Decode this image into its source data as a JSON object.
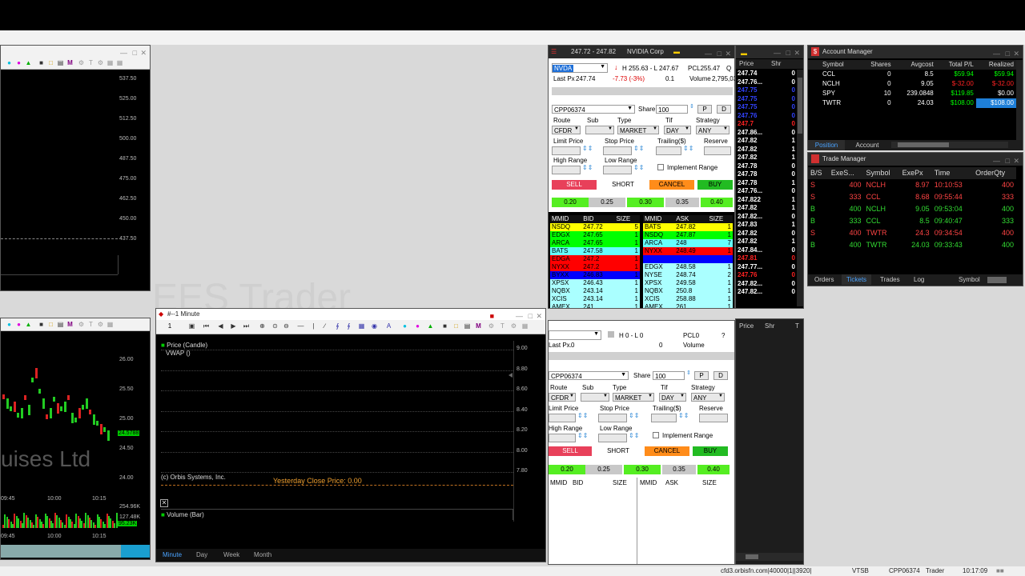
{
  "desktop": {
    "watermark": "EES Trader"
  },
  "chart_top_left": {
    "y_ticks": [
      "537.50",
      "525.00",
      "512.50",
      "500.00",
      "487.50",
      "475.00",
      "462.50",
      "450.00",
      "437.50"
    ]
  },
  "chart_bottom_left": {
    "y_ticks": [
      "26.00",
      "25.50",
      "25.00",
      "24.50",
      "24.00"
    ],
    "price_tag": "24.5788",
    "vol_ticks": [
      "254.96K",
      "127.48K"
    ],
    "vol_tag": "95.23K",
    "x_ticks": [
      "09:45",
      "10:00",
      "10:15"
    ],
    "x_ticks2": [
      "09:45",
      "10:00",
      "10:15"
    ],
    "watermark": "uises Ltd"
  },
  "minute_chart": {
    "title": "#--1 Minute",
    "legend_price": "Price (Candle)",
    "legend_vwap": "VWAP ()",
    "y_ticks": [
      "9.00",
      "8.80",
      "8.60",
      "8.40",
      "8.20",
      "8.00",
      "7.80"
    ],
    "copyright": "(c) Orbis Systems, Inc.",
    "yesterday_close": "Yesterday Close Price: 0.00",
    "volume_legend": "Volume (Bar)",
    "tabs": [
      "Minute",
      "Day",
      "Week",
      "Month"
    ],
    "toolbar_one": "1"
  },
  "order_window_1": {
    "title_range": "247.72 - 247.82",
    "company": "NVIDIA Corp",
    "symbol": "NVDA",
    "hl": "H 255.63 - L 247.67",
    "pcl": "PCL255.47",
    "q": "Q",
    "last_px_label": "Last Px",
    "last_px": "247.74",
    "change": "-7.73 (-3%)",
    "chg2": "0.1",
    "volume_label": "Volume",
    "volume": "2,795,03",
    "account": "CPP06374",
    "share_label": "Share",
    "share": "100",
    "p": "P",
    "d": "D",
    "route_label": "Route",
    "sub_label": "Sub",
    "type_label": "Type",
    "tif_label": "Tif",
    "strategy_label": "Strategy",
    "route": "CFDR",
    "type": "MARKET",
    "tif": "DAY",
    "strategy": "ANY",
    "limit_label": "Limit Price",
    "stop_label": "Stop Price",
    "trailing_label": "Trailing($)",
    "reserve_label": "Reserve",
    "high_range_label": "High Range",
    "low_range_label": "Low Range",
    "implement_range": "Implement Range",
    "sell": "SELL",
    "short": "SHORT",
    "cancel": "CANCEL",
    "buy": "BUY",
    "increments": [
      "0.20",
      "0.25",
      "0.30",
      "0.35",
      "0.40"
    ],
    "bid_headers": [
      "MMID",
      "BID",
      "SIZE"
    ],
    "ask_headers": [
      "MMID",
      "ASK",
      "SIZE"
    ],
    "bids": [
      {
        "mmid": "NSDQ",
        "px": "247.72",
        "size": "5",
        "color": "#ffff00"
      },
      {
        "mmid": "EDGX",
        "px": "247.65",
        "size": "1",
        "color": "#00ff00"
      },
      {
        "mmid": "ARCA",
        "px": "247.65",
        "size": "1",
        "color": "#00ff00"
      },
      {
        "mmid": "BATS",
        "px": "247.58",
        "size": "1",
        "color": "#66ffff"
      },
      {
        "mmid": "EDGA",
        "px": "247.2",
        "size": "1",
        "color": "#ff0000"
      },
      {
        "mmid": "NYXX",
        "px": "247.2",
        "size": "1",
        "color": "#ff0000"
      },
      {
        "mmid": "BYXX",
        "px": "246.83",
        "size": "1",
        "color": "#0000ff"
      },
      {
        "mmid": "XPSX",
        "px": "246.43",
        "size": "1",
        "color": "#aaffff"
      },
      {
        "mmid": "NQBX",
        "px": "243.14",
        "size": "1",
        "color": "#aaffff"
      },
      {
        "mmid": "XCIS",
        "px": "243.14",
        "size": "1",
        "color": "#aaffff"
      },
      {
        "mmid": "AMEX",
        "px": "241",
        "size": "1",
        "color": "#aaffff"
      }
    ],
    "asks": [
      {
        "mmid": "BATS",
        "px": "247.82",
        "size": "1",
        "color": "#ffff00"
      },
      {
        "mmid": "NSDQ",
        "px": "247.87",
        "size": "1",
        "color": "#00ff00"
      },
      {
        "mmid": "ARCA",
        "px": "248",
        "size": "7",
        "color": "#66ffff"
      },
      {
        "mmid": "NYXX",
        "px": "248.49",
        "size": "1",
        "color": "#ff0000"
      },
      {
        "mmid": "",
        "px": "",
        "size": "",
        "color": "#0000ff"
      },
      {
        "mmid": "EDGX",
        "px": "248.58",
        "size": "1",
        "color": "#aaffff"
      },
      {
        "mmid": "NYSE",
        "px": "248.74",
        "size": "2",
        "color": "#aaffff"
      },
      {
        "mmid": "XPSX",
        "px": "249.58",
        "size": "1",
        "color": "#aaffff"
      },
      {
        "mmid": "NQBX",
        "px": "250.8",
        "size": "1",
        "color": "#aaffff"
      },
      {
        "mmid": "XCIS",
        "px": "258.88",
        "size": "1",
        "color": "#aaffff"
      },
      {
        "mmid": "AMEX",
        "px": "261",
        "size": "1",
        "color": "#aaffff"
      }
    ]
  },
  "order_window_2": {
    "hl": "H 0 - L 0",
    "pcl": "PCL0",
    "q": "?",
    "last_px_label": "Last Px.",
    "last_px": "0",
    "chg": "0",
    "volume_label": "Volume",
    "account": "CPP06374",
    "share_label": "Share",
    "share": "100",
    "p": "P",
    "d": "D",
    "route_label": "Route",
    "sub_label": "Sub",
    "type_label": "Type",
    "tif_label": "Tif",
    "strategy_label": "Strategy",
    "route": "CFDR",
    "type": "MARKET",
    "tif": "DAY",
    "strategy": "ANY",
    "limit_label": "Limit Price",
    "stop_label": "Stop Price",
    "trailing_label": "Trailing($)",
    "reserve_label": "Reserve",
    "high_range_label": "High Range",
    "low_range_label": "Low Range",
    "implement_range": "Implement Range",
    "sell": "SELL",
    "short": "SHORT",
    "cancel": "CANCEL",
    "buy": "BUY",
    "increments": [
      "0.20",
      "0.25",
      "0.30",
      "0.35",
      "0.40"
    ],
    "bid_headers": [
      "MMID",
      "BID",
      "SIZE"
    ],
    "ask_headers": [
      "MMID",
      "ASK",
      "SIZE"
    ]
  },
  "time_sales_1": {
    "headers": [
      "Price",
      "Shr"
    ],
    "rows": [
      {
        "px": "247.74",
        "sh": "0",
        "c": "#ffffff"
      },
      {
        "px": "247.76...",
        "sh": "0",
        "c": "#ffffff"
      },
      {
        "px": "247.75",
        "sh": "0",
        "c": "#3344ff"
      },
      {
        "px": "247.75",
        "sh": "0",
        "c": "#3344ff"
      },
      {
        "px": "247.75",
        "sh": "0",
        "c": "#3344ff"
      },
      {
        "px": "247.76",
        "sh": "0",
        "c": "#3344ff"
      },
      {
        "px": "247.7",
        "sh": "0",
        "c": "#ff2222"
      },
      {
        "px": "247.86...",
        "sh": "0",
        "c": "#ffffff"
      },
      {
        "px": "247.82",
        "sh": "1",
        "c": "#ffffff"
      },
      {
        "px": "247.82",
        "sh": "1",
        "c": "#ffffff"
      },
      {
        "px": "247.82",
        "sh": "1",
        "c": "#ffffff"
      },
      {
        "px": "247.78",
        "sh": "0",
        "c": "#ffffff"
      },
      {
        "px": "247.78",
        "sh": "0",
        "c": "#ffffff"
      },
      {
        "px": "247.78",
        "sh": "1",
        "c": "#ffffff"
      },
      {
        "px": "247.76...",
        "sh": "0",
        "c": "#ffffff"
      },
      {
        "px": "247.822",
        "sh": "1",
        "c": "#ffffff"
      },
      {
        "px": "247.82",
        "sh": "1",
        "c": "#ffffff"
      },
      {
        "px": "247.82...",
        "sh": "0",
        "c": "#ffffff"
      },
      {
        "px": "247.83",
        "sh": "1",
        "c": "#ffffff"
      },
      {
        "px": "247.82",
        "sh": "0",
        "c": "#ffffff"
      },
      {
        "px": "247.82",
        "sh": "1",
        "c": "#ffffff"
      },
      {
        "px": "247.84...",
        "sh": "0",
        "c": "#ffffff"
      },
      {
        "px": "247.81",
        "sh": "0",
        "c": "#ff2222"
      },
      {
        "px": "247.77...",
        "sh": "0",
        "c": "#ffffff"
      },
      {
        "px": "247.76",
        "sh": "0",
        "c": "#ff2222"
      },
      {
        "px": "247.82...",
        "sh": "0",
        "c": "#ffffff"
      },
      {
        "px": "247.82...",
        "sh": "0",
        "c": "#ffffff"
      }
    ]
  },
  "time_sales_2": {
    "headers": [
      "Price",
      "Shr",
      "T"
    ]
  },
  "account_manager": {
    "title": "Account Manager",
    "headers": [
      "Symbol",
      "Shares",
      "Avgcost",
      "Total P/L",
      "Realized"
    ],
    "rows": [
      {
        "sym": "CCL",
        "sh": "0",
        "avg": "8.5",
        "tpl": "$59.94",
        "real": "$59.94",
        "tc": "#00ff00",
        "rc": "#00ff00",
        "rbg": "#000"
      },
      {
        "sym": "NCLH",
        "sh": "0",
        "avg": "9.05",
        "tpl": "$-32.00",
        "real": "$-32.00",
        "tc": "#ff2222",
        "rc": "#ff2222",
        "rbg": "#000"
      },
      {
        "sym": "SPY",
        "sh": "10",
        "avg": "239.0848",
        "tpl": "$119.85",
        "real": "$0.00",
        "tc": "#00ff00",
        "rc": "#ffffff",
        "rbg": "#000"
      },
      {
        "sym": "TWTR",
        "sh": "0",
        "avg": "24.03",
        "tpl": "$108.00",
        "real": "$108.00",
        "tc": "#00ff00",
        "rc": "#ffffff",
        "rbg": "#1e7fd8"
      }
    ],
    "tabs": [
      "Position",
      "Account"
    ]
  },
  "trade_manager": {
    "title": "Trade Manager",
    "headers": [
      "B/S",
      "ExeS...",
      "Symbol",
      "ExePx",
      "Time",
      "OrderQty"
    ],
    "rows": [
      {
        "bs": "S",
        "exe": "400",
        "sym": "NCLH",
        "px": "8.97",
        "time": "10:10:53",
        "qty": "400",
        "c": "#ff4444"
      },
      {
        "bs": "S",
        "exe": "333",
        "sym": "CCL",
        "px": "8.68",
        "time": "09:55:44",
        "qty": "333",
        "c": "#ff4444"
      },
      {
        "bs": "B",
        "exe": "400",
        "sym": "NCLH",
        "px": "9.05",
        "time": "09:53:04",
        "qty": "400",
        "c": "#33dd33"
      },
      {
        "bs": "B",
        "exe": "333",
        "sym": "CCL",
        "px": "8.5",
        "time": "09:40:47",
        "qty": "333",
        "c": "#33dd33"
      },
      {
        "bs": "S",
        "exe": "400",
        "sym": "TWTR",
        "px": "24.3",
        "time": "09:34:54",
        "qty": "400",
        "c": "#ff4444"
      },
      {
        "bs": "B",
        "exe": "400",
        "sym": "TWTR",
        "px": "24.03",
        "time": "09:33:43",
        "qty": "400",
        "c": "#33dd33"
      }
    ],
    "tabs": [
      "Orders",
      "Tickets",
      "Trades",
      "Log",
      "Symbol"
    ]
  },
  "status": {
    "server": "cfd3.orbisfn.com|40000|1||3920|",
    "exchange": "VTSB",
    "account": "CPP06374",
    "role": "Trader",
    "time": "10:17:09"
  }
}
